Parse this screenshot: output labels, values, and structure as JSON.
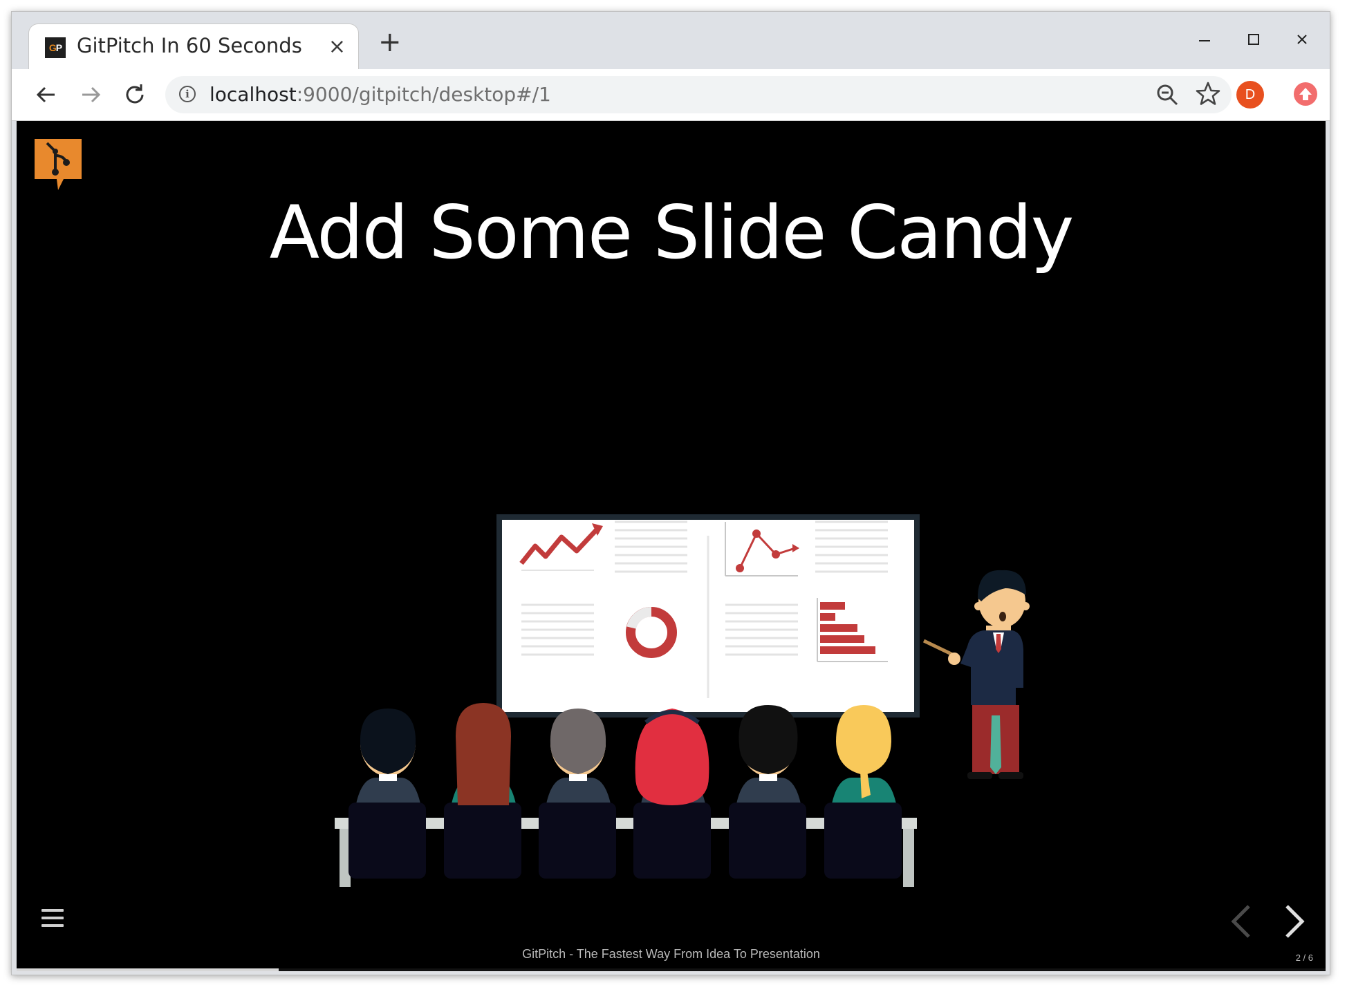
{
  "browser": {
    "tab": {
      "favicon_text_g": "G",
      "favicon_text_p": "P",
      "title": "GitPitch In 60 Seconds",
      "close_glyph": "×"
    },
    "new_tab_glyph": "+",
    "window_controls": {
      "minimize": "—",
      "maximize": "☐",
      "close": "✕"
    },
    "address": {
      "host": "localhost",
      "rest": ":9000/gitpitch/desktop#/1"
    },
    "profile_initial": "D",
    "profile_color": "#e8501f"
  },
  "slide": {
    "title": "Add Some Slide Candy",
    "footer": "GitPitch - The Fastest Way From Idea To Presentation",
    "counter": "2 / 6",
    "progress": 0.2,
    "logo_color": "#e8892d",
    "accent_red": "#c0392b"
  }
}
